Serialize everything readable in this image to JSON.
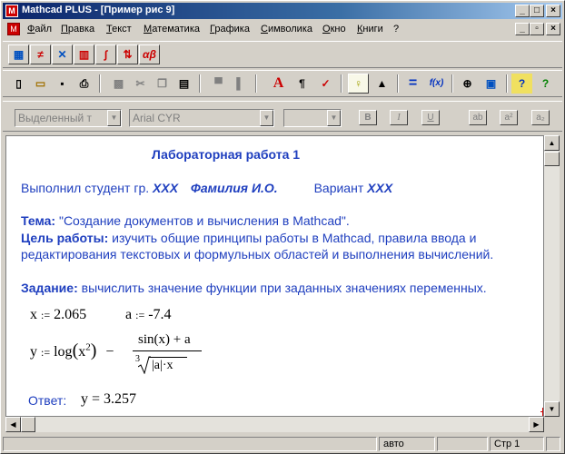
{
  "window": {
    "title": "Mathcad PLUS - [Пример рис 9]",
    "app_icon": "M"
  },
  "titlebar_buttons": {
    "minimize": "_",
    "maximize": "□",
    "close": "×"
  },
  "menubar": {
    "doc_icon": "M",
    "items": [
      "Файл",
      "Правка",
      "Текст",
      "Математика",
      "Графика",
      "Символика",
      "Окно",
      "Книги",
      "?"
    ],
    "doc_buttons": {
      "minimize": "_",
      "restore": "▫",
      "close": "×"
    }
  },
  "palette_toolbar": {
    "buttons": [
      {
        "icon": "calculator-icon",
        "glyph": "▦"
      },
      {
        "icon": "evaluation-icon",
        "glyph": "≠"
      },
      {
        "icon": "graph-icon",
        "glyph": "✕"
      },
      {
        "icon": "matrix-icon",
        "glyph": "▥"
      },
      {
        "icon": "calculus-icon",
        "glyph": "∫"
      },
      {
        "icon": "programming-icon",
        "glyph": "⇅"
      },
      {
        "icon": "greek-icon",
        "glyph": "αβ"
      }
    ]
  },
  "standard_toolbar": {
    "buttons": [
      {
        "icon": "new-document-icon",
        "glyph": "▯"
      },
      {
        "icon": "open-folder-icon",
        "glyph": "▭"
      },
      {
        "icon": "save-icon",
        "glyph": "▪"
      },
      {
        "icon": "print-icon",
        "glyph": "⎙"
      },
      {
        "icon": "check-icon",
        "glyph": "▩"
      },
      {
        "icon": "cut-icon",
        "glyph": "✂"
      },
      {
        "icon": "copy-icon",
        "glyph": "❐"
      },
      {
        "icon": "paste-icon",
        "glyph": "▤"
      },
      {
        "icon": "align-top-icon",
        "glyph": "▀"
      },
      {
        "icon": "align-left-icon",
        "glyph": "▌"
      },
      {
        "icon": "text-region-icon",
        "glyph": "A"
      },
      {
        "icon": "paragraph-icon",
        "glyph": "¶"
      },
      {
        "icon": "spellcheck-icon",
        "glyph": "✓"
      },
      {
        "icon": "lightbulb-icon",
        "glyph": "♀"
      },
      {
        "icon": "resource-icon",
        "glyph": "▲"
      },
      {
        "icon": "equals-icon",
        "glyph": "="
      },
      {
        "icon": "function-icon",
        "glyph": "f(x)"
      },
      {
        "icon": "zoom-icon",
        "glyph": "⊕"
      },
      {
        "icon": "calculate-icon",
        "glyph": "▣"
      },
      {
        "icon": "help-book-icon",
        "glyph": "?"
      },
      {
        "icon": "help-icon",
        "glyph": "?"
      }
    ]
  },
  "format_toolbar": {
    "style_combo": "Выделенный т",
    "font_combo": "Arial CYR",
    "size_combo": "",
    "bold": "B",
    "italic": "I",
    "underline": "U",
    "align_left": "ab",
    "superscript": "a²",
    "subscript": "a₂"
  },
  "worksheet": {
    "heading": "Лабораторная работа 1",
    "author_prefix": "Выполнил студент гр. ",
    "group": "XXX",
    "student": "Фамилия И.О.",
    "variant_label": "Вариант ",
    "variant": "XXX",
    "theme_label": "Тема:",
    "theme_text": " \"Создание документов и вычисления в Mathcad\".",
    "goal_label": "Цель работы:",
    "goal_text_1": " изучить общие принципы работы в Mathcad, правила ввода и",
    "goal_text_2": "редактирования текстовых и формульных областей и выполнения вычислений.",
    "task_label": "Задание:",
    "task_text": " вычислить значение функции при заданных значениях переменных.",
    "x_name": "x",
    "x_value": "2.065",
    "a_name": "a",
    "a_value": "-7.4",
    "assign_op": ":=",
    "y_name": "y",
    "y_log": "log",
    "y_log_arg": "x",
    "y_exp": "2",
    "y_minus": "−",
    "y_num": "sin(x) + a",
    "y_root_index": "3",
    "y_den": "|a|·x",
    "answer_label": "Ответ:",
    "answer_var": "y",
    "answer_eq": "=",
    "answer_value": "3.257"
  },
  "statusbar": {
    "mode": "авто",
    "page": "Стр 1"
  }
}
